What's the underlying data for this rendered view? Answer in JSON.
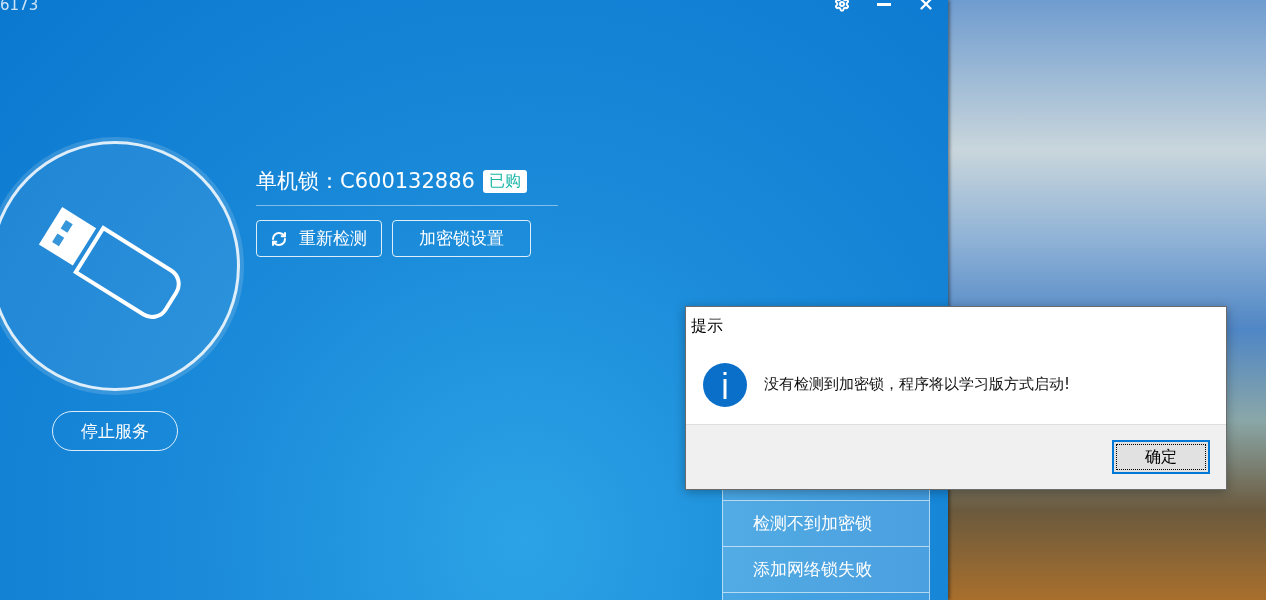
{
  "window": {
    "title": "6173"
  },
  "lock": {
    "label": "单机锁：C600132886",
    "badge": "已购"
  },
  "actions": [
    {
      "label": "重新检测",
      "kind": "refresh"
    },
    {
      "label": "加密锁设置",
      "kind": "plain"
    }
  ],
  "service_button": "停止服务",
  "menu": {
    "items": [
      {
        "label": "检测不到加密锁"
      },
      {
        "label": "添加网络锁失败"
      }
    ]
  },
  "dialog": {
    "title": "提示",
    "message": "没有检测到加密锁，程序将以学习版方式启动!",
    "ok_button": "确定"
  }
}
